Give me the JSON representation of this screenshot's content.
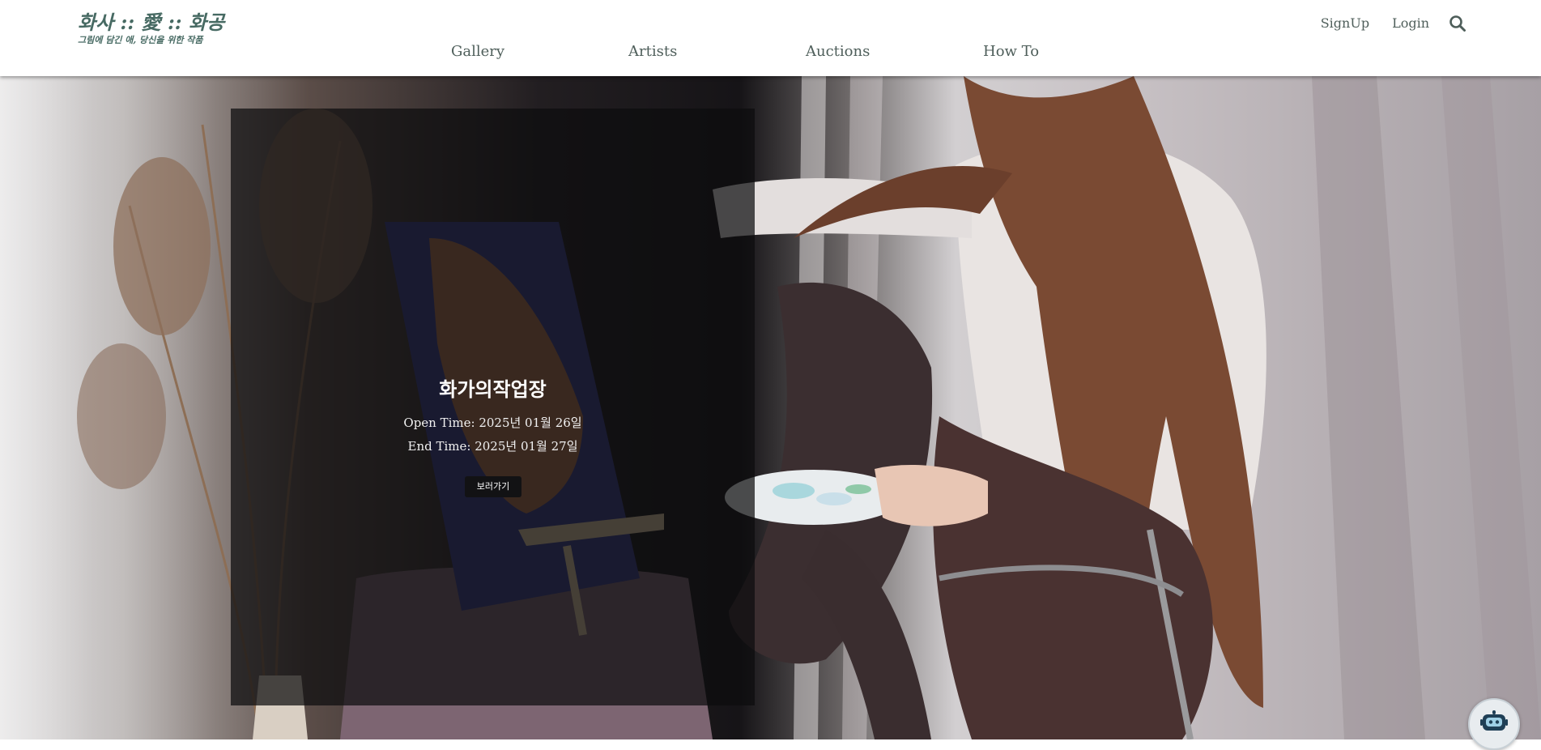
{
  "logo": {
    "title": "화사 :: 愛 :: 화공",
    "subtitle": "그림에 담긴 애, 당신을 위한 작품"
  },
  "nav": {
    "items": [
      {
        "label": "Gallery"
      },
      {
        "label": "Artists"
      },
      {
        "label": "Auctions"
      },
      {
        "label": "How To"
      }
    ]
  },
  "top_links": {
    "signup": "SignUp",
    "login": "Login"
  },
  "icons": {
    "search": "search-icon",
    "chatbot": "robot-icon"
  },
  "hero": {
    "title": "화가의작업장",
    "open_time": "Open Time: 2025년 01월 26일",
    "end_time": "End Time: 2025년 01월 27일",
    "button_label": "보러가기"
  },
  "colors": {
    "logo": "#476a63",
    "nav_text": "#4e5e5a",
    "panel_overlay": "rgba(12,12,14,0.72)",
    "button_bg": "#121214"
  }
}
